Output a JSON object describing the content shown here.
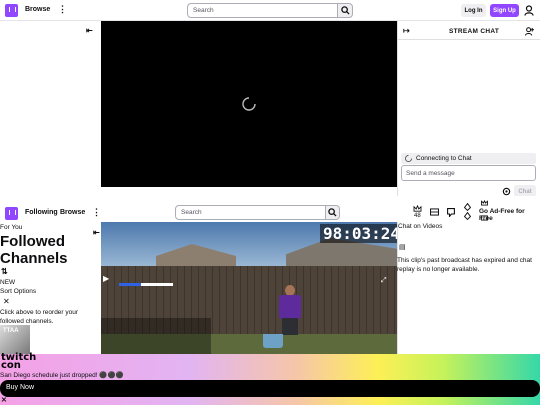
{
  "top_nav": {
    "browse": "Browse",
    "search_placeholder": "Search",
    "login": "Log In",
    "signup": "Sign Up"
  },
  "chat": {
    "title": "STREAM CHAT",
    "connecting": "Connecting to Chat",
    "send_placeholder": "Send a message",
    "chat_button": "Chat"
  },
  "lower_nav": {
    "following": "Following",
    "browse": "Browse",
    "search_placeholder": "Search"
  },
  "sidebar": {
    "for_you": "For You",
    "followed_title": "Followed Channels",
    "sort_label": "NEW",
    "sort_options": "Sort Options",
    "reorder_hint": "Click above to reorder your followed channels."
  },
  "video": {
    "timer": "98:03:24"
  },
  "lower_icons": {
    "count": "48",
    "ad_free": "Go Ad-Free for Free"
  },
  "chat_videos": {
    "title": "Chat on Videos",
    "expired": "This clip's past broadcast has expired and chat replay is no longer available."
  },
  "banner": {
    "brand_line1": "twitch",
    "brand_line2": "con",
    "headline": "San Diego schedule just dropped! ⚫⚫⚫",
    "buy_now": "Buy Now",
    "close": "✕"
  }
}
